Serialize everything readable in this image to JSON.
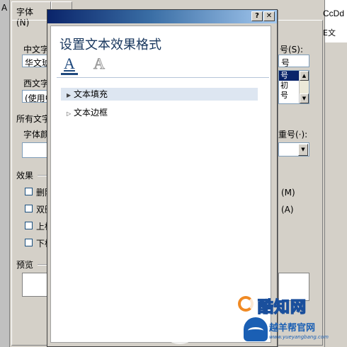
{
  "left_strip": {
    "glyph": "A"
  },
  "font_dialog": {
    "tabs": [
      "字体(N)",
      ""
    ],
    "chinese_font_label": "中文字",
    "chinese_font_value": "华文琥",
    "western_font_label": "西文字",
    "western_font_value": "(使用中",
    "size_label": "号(S):",
    "size_value": "号",
    "size_list": [
      "号",
      "初",
      "号"
    ],
    "all_text_label": "所有文字",
    "font_color_label": "字体颜",
    "underline_label": "重号(·):",
    "effects_label": "效果",
    "effect_checkboxes": [
      "删除",
      "双删",
      "上标",
      "下标"
    ],
    "effect_right_labels": [
      "(M)",
      "(A)"
    ],
    "preview_label": "预览"
  },
  "style_gallery": {
    "sample": "CcDd",
    "caption": "E文"
  },
  "effects_dialog": {
    "help_glyph": "?",
    "close_glyph": "✕",
    "title": "设置文本效果格式",
    "tab_fill_glyph": "A",
    "tab_outline_glyph": "A",
    "sections": [
      {
        "label": "文本填充",
        "expanded": false,
        "active": true
      },
      {
        "label": "文本边框",
        "expanded": false,
        "active": false
      }
    ]
  },
  "watermarks": {
    "site1": "酷知网",
    "site2": "越羊帮官网",
    "site2_url": "www.yueyangbang.com"
  },
  "colors": {
    "title_text": "#17365d",
    "active_section": "#dde6f1",
    "titlebar_start": "#0a246a"
  }
}
